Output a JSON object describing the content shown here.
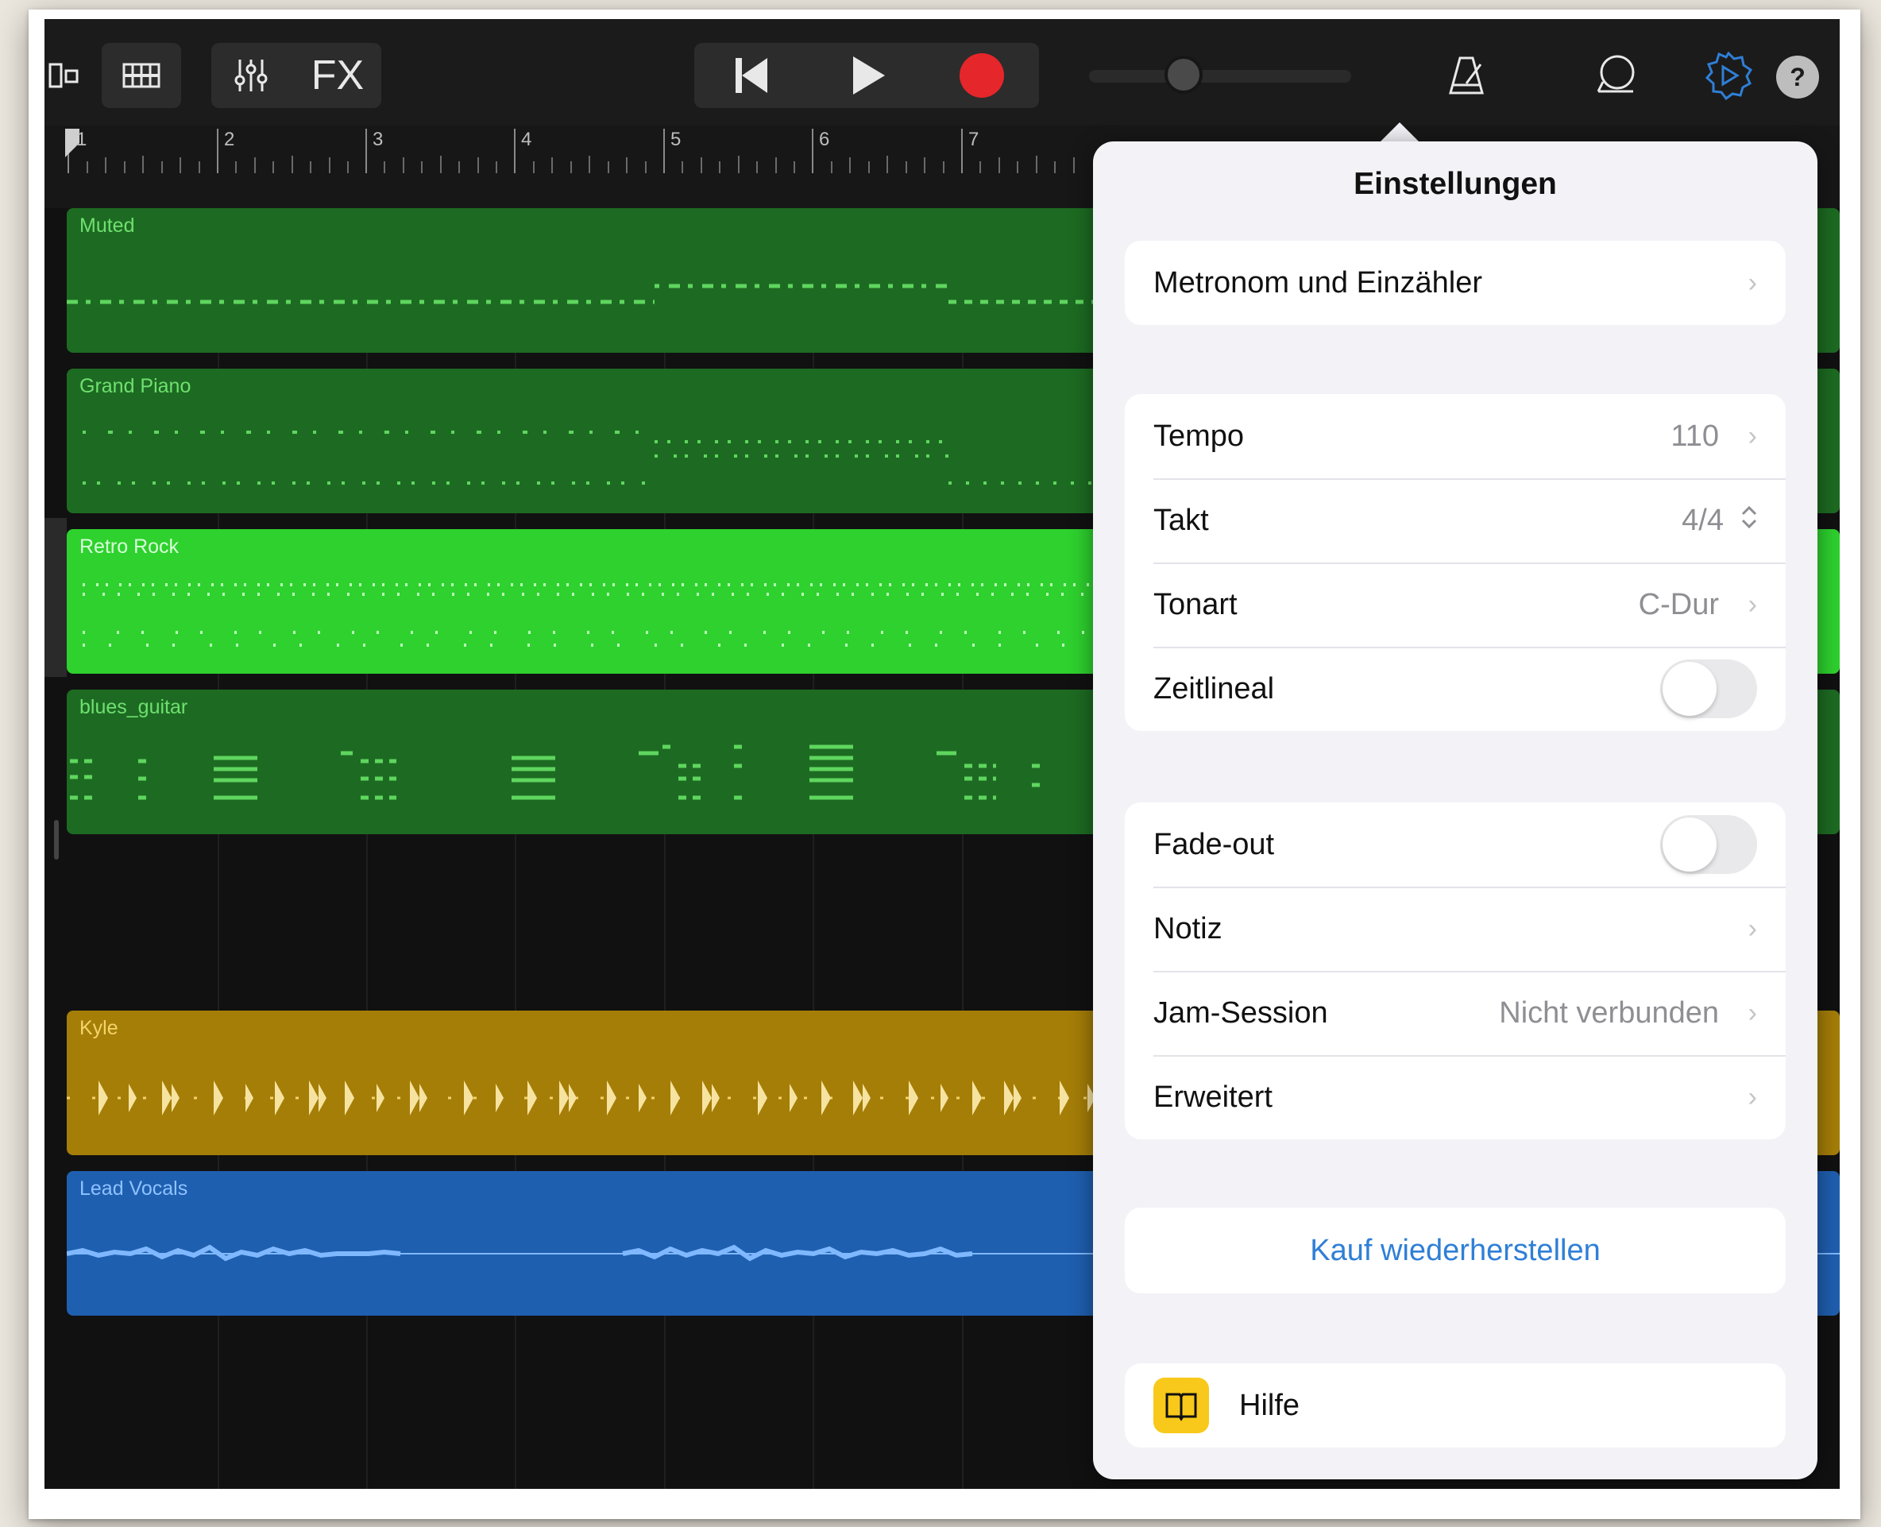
{
  "toolbar": {
    "fx_label": "FX",
    "help_label": "?"
  },
  "ruler": {
    "bars": [
      "1",
      "2",
      "3",
      "4",
      "5",
      "6",
      "7"
    ]
  },
  "tracks": [
    {
      "name": "Muted",
      "color": "#1d6b22",
      "label_color": "#6fe06f"
    },
    {
      "name": "Grand Piano",
      "color": "#1d6b22",
      "label_color": "#6fe06f"
    },
    {
      "name": "Retro Rock",
      "color": "#2ed12e",
      "label_color": "#d8ffd8"
    },
    {
      "name": "blues_guitar",
      "color": "#1d6b22",
      "label_color": "#6fe06f"
    },
    {
      "name": "Kyle",
      "color": "#a57e08",
      "label_color": "#f3d46a"
    },
    {
      "name": "Lead Vocals",
      "color": "#1f5fb0",
      "label_color": "#8ec2ff"
    }
  ],
  "settings": {
    "title": "Einstellungen",
    "metronome": {
      "label": "Metronom und Einzähler"
    },
    "tempo": {
      "label": "Tempo",
      "value": "110"
    },
    "takt": {
      "label": "Takt",
      "value": "4/4"
    },
    "tonart": {
      "label": "Tonart",
      "value": "C-Dur"
    },
    "zeitlineal": {
      "label": "Zeitlineal",
      "on": false
    },
    "fadeout": {
      "label": "Fade-out",
      "on": false
    },
    "notiz": {
      "label": "Notiz"
    },
    "jam": {
      "label": "Jam-Session",
      "value": "Nicht verbunden"
    },
    "erweitert": {
      "label": "Erweitert"
    },
    "restore": {
      "label": "Kauf wiederherstellen"
    },
    "hilfe": {
      "label": "Hilfe"
    }
  },
  "colors": {
    "accent_blue": "#2f7fd6",
    "record_red": "#e5262a",
    "help_yellow": "#f8c91a"
  }
}
